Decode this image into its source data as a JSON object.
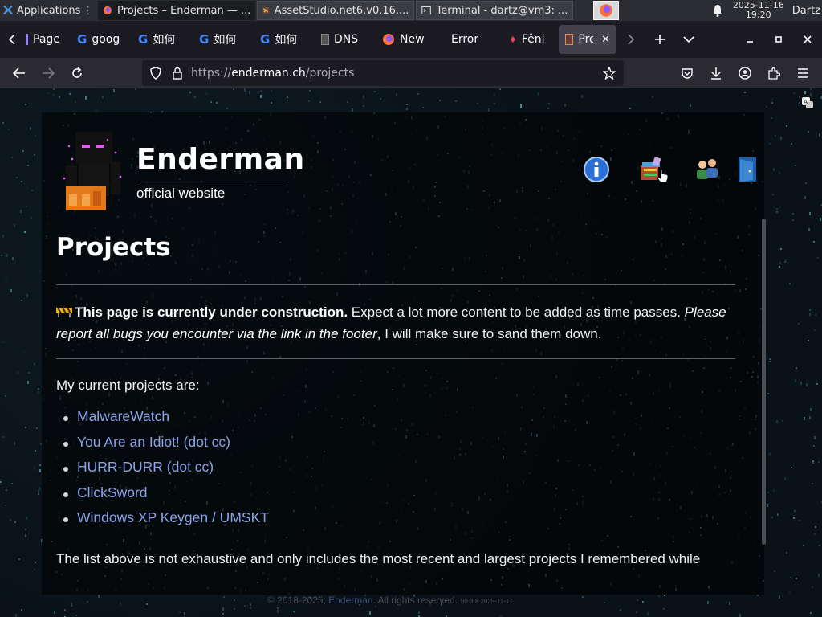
{
  "taskbar": {
    "apps_label": "Applications",
    "windows": [
      {
        "label": "Projects – Enderman — ..."
      },
      {
        "label": "AssetStudio.net6.v0.16...."
      },
      {
        "label": "Terminal - dartz@vm3: ..."
      }
    ],
    "clock_date": "2025-11-16",
    "clock_time": "19:20",
    "user": "Dartz"
  },
  "browser": {
    "tabs": [
      {
        "label": "Page",
        "icon": "page-icon"
      },
      {
        "label": "goog",
        "icon": "google-icon"
      },
      {
        "label": "如何",
        "icon": "google-icon"
      },
      {
        "label": "如何",
        "icon": "google-icon"
      },
      {
        "label": "如何",
        "icon": "google-icon"
      },
      {
        "label": "DNS",
        "icon": "dns-icon"
      },
      {
        "label": "New",
        "icon": "firefox-icon"
      },
      {
        "label": "Error",
        "icon": ""
      },
      {
        "label": "Fêni",
        "icon": "phoenix-icon"
      },
      {
        "label": "Pro",
        "icon": "enderman-favicon"
      }
    ],
    "url_prefix": "https://",
    "url_host": "enderman.ch",
    "url_path": "/projects"
  },
  "site": {
    "title": "Enderman",
    "subtitle": "official website",
    "nav_icons": [
      "info-icon",
      "projects-icon",
      "users-icon",
      "exit-door-icon"
    ]
  },
  "page": {
    "title": "Projects",
    "notice_bold": "This page is currently under construction.",
    "notice_text": " Expect a lot more content to be added as time passes. ",
    "notice_italic": "Please report all bugs you encounter via the link in the footer",
    "notice_end": ", I will make sure to sand them down.",
    "intro": "My current projects are:",
    "projects": [
      "MalwareWatch",
      "You Are an Idiot! (dot cc)",
      "HURR-DURR (dot cc)",
      "ClickSword",
      "Windows XP Keygen / UMSKT"
    ],
    "outro": "The list above is not exhaustive and only includes the most recent and largest projects I remembered while"
  },
  "footer": {
    "prefix": "© 2018-2025, ",
    "link": "Enderman",
    "suffix": ". All rights reserved.",
    "version": "b0.3.8 2025-11-17"
  }
}
